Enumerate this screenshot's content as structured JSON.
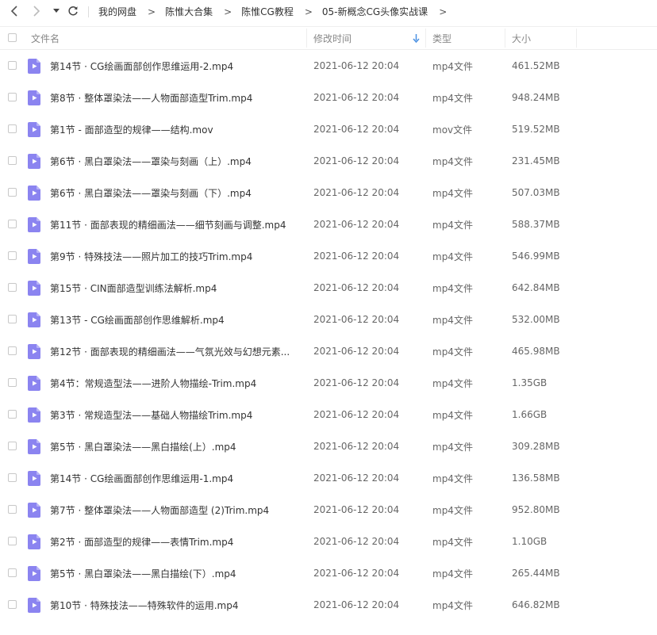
{
  "nav": {
    "breadcrumbs": [
      "我的网盘",
      "陈惟大合集",
      "陈惟CG教程",
      "05-新概念CG头像实战课"
    ],
    "separator": ">"
  },
  "header": {
    "name": "文件名",
    "modified": "修改时间",
    "type": "类型",
    "size": "大小"
  },
  "colors": {
    "accent": "#4a90e2",
    "file_icon": "#8b84f0"
  },
  "files": [
    {
      "name": "第14节 · CG绘画面部创作思维运用-2.mp4",
      "time": "2021-06-12 20:04",
      "type": "mp4文件",
      "size": "461.52MB"
    },
    {
      "name": "第8节 · 整体罩染法——人物面部造型Trim.mp4",
      "time": "2021-06-12 20:04",
      "type": "mp4文件",
      "size": "948.24MB"
    },
    {
      "name": "第1节 - 面部造型的规律——结构.mov",
      "time": "2021-06-12 20:04",
      "type": "mov文件",
      "size": "519.52MB"
    },
    {
      "name": "第6节 · 黑白罩染法——罩染与刻画（上）.mp4",
      "time": "2021-06-12 20:04",
      "type": "mp4文件",
      "size": "231.45MB"
    },
    {
      "name": "第6节 · 黑白罩染法——罩染与刻画（下）.mp4",
      "time": "2021-06-12 20:04",
      "type": "mp4文件",
      "size": "507.03MB"
    },
    {
      "name": "第11节 · 面部表现的精细画法——细节刻画与调整.mp4",
      "time": "2021-06-12 20:04",
      "type": "mp4文件",
      "size": "588.37MB"
    },
    {
      "name": "第9节 · 特殊技法——照片加工的技巧Trim.mp4",
      "time": "2021-06-12 20:04",
      "type": "mp4文件",
      "size": "546.99MB"
    },
    {
      "name": "第15节 · CIN面部造型训练法解析.mp4",
      "time": "2021-06-12 20:04",
      "type": "mp4文件",
      "size": "642.84MB"
    },
    {
      "name": "第13节 - CG绘画面部创作思维解析.mp4",
      "time": "2021-06-12 20:04",
      "type": "mp4文件",
      "size": "532.00MB"
    },
    {
      "name": "第12节 · 面部表现的精细画法——气氛光效与幻想元素...",
      "time": "2021-06-12 20:04",
      "type": "mp4文件",
      "size": "465.98MB"
    },
    {
      "name": "第4节：常规造型法——进阶人物描绘-Trim.mp4",
      "time": "2021-06-12 20:04",
      "type": "mp4文件",
      "size": "1.35GB"
    },
    {
      "name": "第3节 · 常规造型法——基础人物描绘Trim.mp4",
      "time": "2021-06-12 20:04",
      "type": "mp4文件",
      "size": "1.66GB"
    },
    {
      "name": "第5节 · 黑白罩染法——黑白描绘(上）.mp4",
      "time": "2021-06-12 20:04",
      "type": "mp4文件",
      "size": "309.28MB"
    },
    {
      "name": "第14节 · CG绘画面部创作思维运用-1.mp4",
      "time": "2021-06-12 20:04",
      "type": "mp4文件",
      "size": "136.58MB"
    },
    {
      "name": "第7节 · 整体罩染法——人物面部造型 (2)Trim.mp4",
      "time": "2021-06-12 20:04",
      "type": "mp4文件",
      "size": "952.80MB"
    },
    {
      "name": "第2节 · 面部造型的规律——表情Trim.mp4",
      "time": "2021-06-12 20:04",
      "type": "mp4文件",
      "size": "1.10GB"
    },
    {
      "name": "第5节 · 黑白罩染法——黑白描绘(下）.mp4",
      "time": "2021-06-12 20:04",
      "type": "mp4文件",
      "size": "265.44MB"
    },
    {
      "name": "第10节 · 特殊技法——特殊软件的运用.mp4",
      "time": "2021-06-12 20:04",
      "type": "mp4文件",
      "size": "646.82MB"
    }
  ]
}
